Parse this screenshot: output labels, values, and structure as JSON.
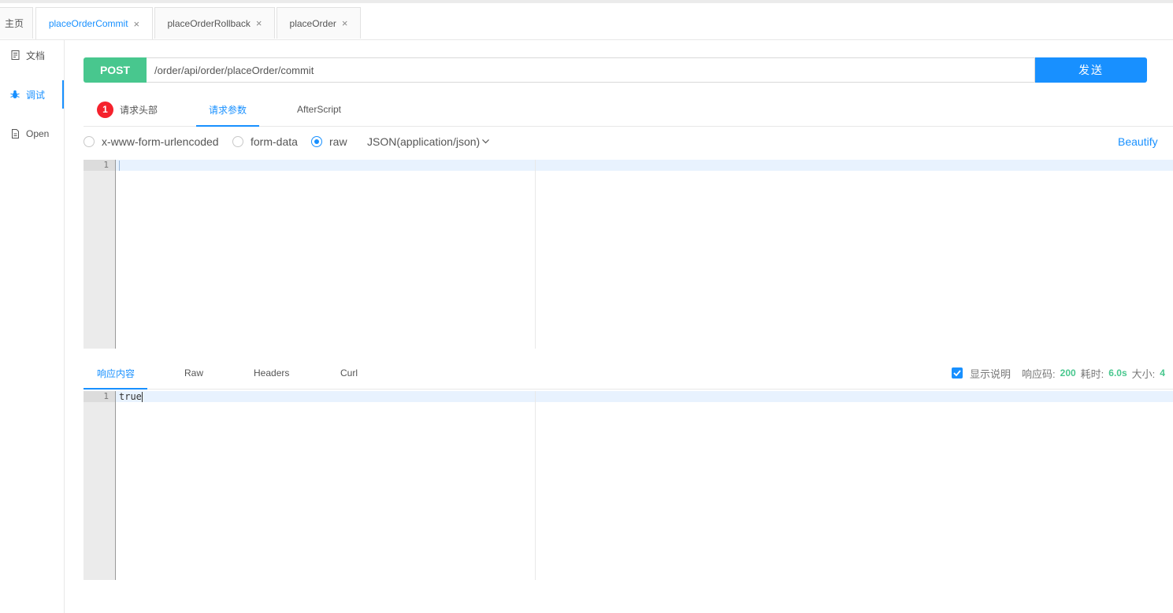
{
  "tabs": [
    {
      "label": "主页",
      "closable": false
    },
    {
      "label": "placeOrderCommit",
      "closable": true,
      "active": true
    },
    {
      "label": "placeOrderRollback",
      "closable": true
    },
    {
      "label": "placeOrder",
      "closable": true
    }
  ],
  "close_glyph": "×",
  "sidebar": {
    "items": [
      {
        "label": "文档",
        "icon": "document-icon"
      },
      {
        "label": "调试",
        "icon": "bug-icon",
        "active": true
      },
      {
        "label": "Open",
        "icon": "file-icon"
      }
    ]
  },
  "request": {
    "method": "POST",
    "url": "/order/api/order/placeOrder/commit",
    "send_label": "发送",
    "tabs": [
      {
        "label": "请求头部",
        "badge": "1"
      },
      {
        "label": "请求参数",
        "active": true
      },
      {
        "label": "AfterScript"
      }
    ],
    "body_types": [
      {
        "label": "x-www-form-urlencoded",
        "checked": false
      },
      {
        "label": "form-data",
        "checked": false
      },
      {
        "label": "raw",
        "checked": true
      }
    ],
    "content_type": "JSON(application/json)",
    "beautify_label": "Beautify",
    "editor": {
      "line_numbers": [
        "1"
      ],
      "lines": [
        ""
      ]
    }
  },
  "response": {
    "tabs": [
      {
        "label": "响应内容",
        "active": true
      },
      {
        "label": "Raw"
      },
      {
        "label": "Headers"
      },
      {
        "label": "Curl"
      }
    ],
    "show_desc_label": "显示说明",
    "show_desc_checked": true,
    "status_label": "响应码:",
    "status_value": "200",
    "time_label": "耗时:",
    "time_value": "6.0s",
    "size_label": "大小:",
    "size_value": "4",
    "editor": {
      "line_numbers": [
        "1"
      ],
      "lines": [
        "true"
      ]
    }
  },
  "colors": {
    "accent": "#1890ff",
    "method": "#48c78e",
    "badge": "#f5222d",
    "status_ok": "#48c78e"
  }
}
